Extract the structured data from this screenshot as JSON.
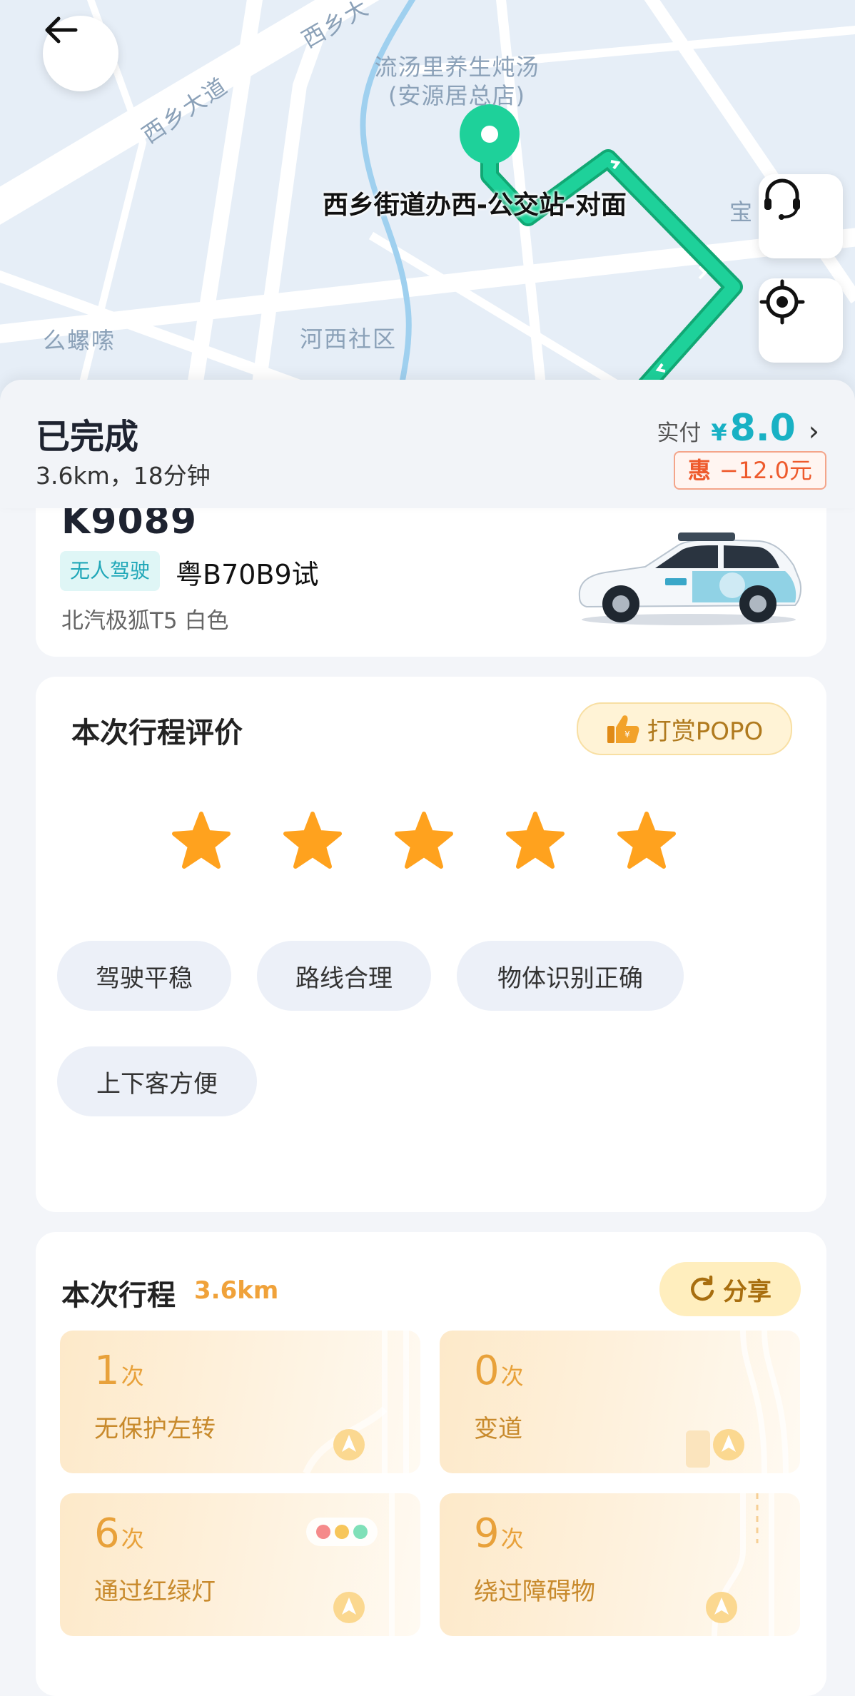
{
  "map": {
    "road_labels": [
      "西乡大道",
      "西乡大"
    ],
    "poi": {
      "line1": "流汤里养生炖汤",
      "line2": "(安源居总店)"
    },
    "station": "西乡街道办西-公交站-对面",
    "areas": [
      "么螺嗦",
      "河西社区",
      "宝"
    ],
    "route_color": "#1ed19a"
  },
  "status": {
    "title": "已完成",
    "subtitle": "3.6km，18分钟",
    "paid_label": "实付",
    "currency": "¥",
    "paid_amount": "8.0",
    "arrow": "›",
    "discount_badge": "惠",
    "discount_value": "−12.0元"
  },
  "vehicle": {
    "id": "K9089",
    "tag": "无人驾驶",
    "plate": "粤B70B9试",
    "model": "北汽极狐T5 白色"
  },
  "rating": {
    "title": "本次行程评价",
    "tip_button": "打赏POPO",
    "stars": 5,
    "max_stars": 5,
    "tags": [
      "驾驶平稳",
      "路线合理",
      "物体识别正确",
      "上下客方便"
    ]
  },
  "trip": {
    "title": "本次行程",
    "distance": "3.6km",
    "share_button": "分享",
    "stats": [
      {
        "count": "1",
        "unit": "次",
        "label": "无保护左转"
      },
      {
        "count": "0",
        "unit": "次",
        "label": "变道"
      },
      {
        "count": "6",
        "unit": "次",
        "label": "通过红绿灯"
      },
      {
        "count": "9",
        "unit": "次",
        "label": "绕过障碍物"
      }
    ]
  },
  "colors": {
    "accent_teal": "#19b1c4",
    "discount_orange": "#ee5a2c",
    "star_orange": "#ffa21e",
    "stat_orange": "#e8a13a"
  }
}
